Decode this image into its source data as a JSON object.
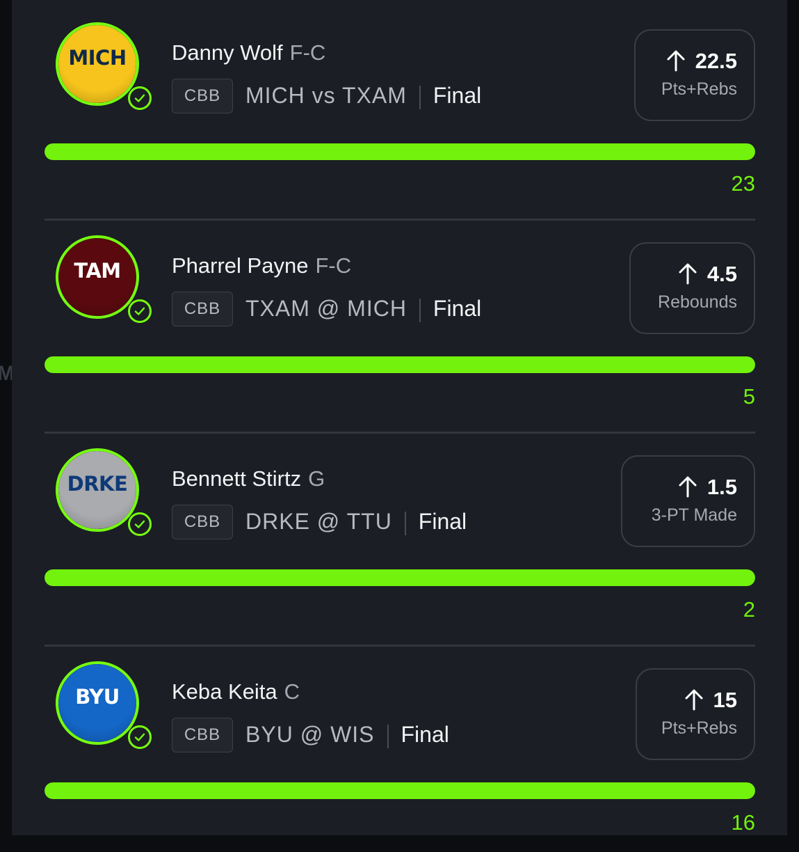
{
  "colors": {
    "accent_green": "#72f20c",
    "panel_bg": "#1b1e24",
    "page_bg": "#0b0d10"
  },
  "background_glyph": "M",
  "picks": [
    {
      "player": "Danny Wolf",
      "position": "F-C",
      "jersey_label": "MICH",
      "jersey_color": "#f6c41c",
      "jersey_text_color": "#10284a",
      "league": "CBB",
      "matchup": "MICH vs TXAM",
      "status": "Final",
      "direction_icon": "arrow-up-icon",
      "line": "22.5",
      "stat": "Pts+Rebs",
      "progress_fraction": 1.0,
      "result": "23"
    },
    {
      "player": "Pharrel Payne",
      "position": "F-C",
      "jersey_label": "TAM",
      "jersey_color": "#5a0a0e",
      "jersey_text_color": "#ffffff",
      "league": "CBB",
      "matchup": "TXAM @ MICH",
      "status": "Final",
      "direction_icon": "arrow-up-icon",
      "line": "4.5",
      "stat": "Rebounds",
      "progress_fraction": 1.0,
      "result": "5"
    },
    {
      "player": "Bennett Stirtz",
      "position": "G",
      "jersey_label": "DRKE",
      "jersey_color": "#a9abae",
      "jersey_text_color": "#0f3a78",
      "league": "CBB",
      "matchup": "DRKE @ TTU",
      "status": "Final",
      "direction_icon": "arrow-up-icon",
      "line": "1.5",
      "stat": "3-PT Made",
      "progress_fraction": 1.0,
      "result": "2"
    },
    {
      "player": "Keba Keita",
      "position": "C",
      "jersey_label": "BYU",
      "jersey_color": "#1466c7",
      "jersey_text_color": "#ffffff",
      "league": "CBB",
      "matchup": "BYU @ WIS",
      "status": "Final",
      "direction_icon": "arrow-up-icon",
      "line": "15",
      "stat": "Pts+Rebs",
      "progress_fraction": 1.0,
      "result": "16"
    }
  ]
}
